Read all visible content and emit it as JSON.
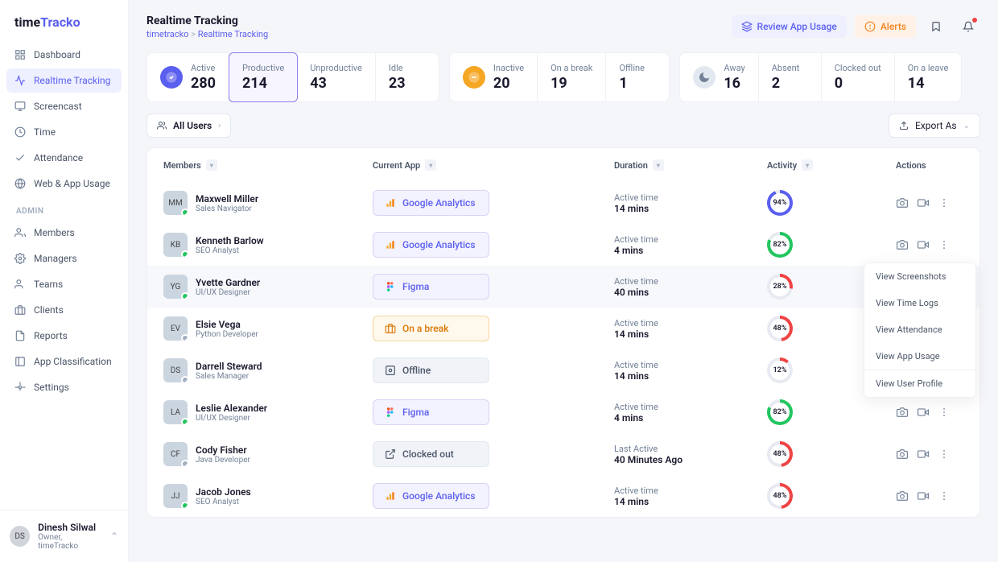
{
  "brand": {
    "part1": "time",
    "part2": "Tracko"
  },
  "nav": {
    "items": [
      {
        "label": "Dashboard"
      },
      {
        "label": "Realtime Tracking"
      },
      {
        "label": "Screencast"
      },
      {
        "label": "Time"
      },
      {
        "label": "Attendance"
      },
      {
        "label": "Web & App Usage"
      }
    ],
    "admin_label": "ADMIN",
    "admin_items": [
      {
        "label": "Members"
      },
      {
        "label": "Managers"
      },
      {
        "label": "Teams"
      },
      {
        "label": "Clients"
      },
      {
        "label": "Reports"
      },
      {
        "label": "App Classification"
      },
      {
        "label": "Settings"
      }
    ]
  },
  "current_user": {
    "name": "Dinesh Silwal",
    "role": "Owner, timeTracko"
  },
  "page": {
    "title": "Realtime Tracking",
    "breadcrumb_root": "timetracko",
    "breadcrumb_sep": ">",
    "breadcrumb_current": "Realtime Tracking"
  },
  "header_actions": {
    "review": "Review App Usage",
    "alerts": "Alerts"
  },
  "stats": {
    "group1": [
      {
        "label": "Active",
        "value": "280",
        "icon": "check"
      },
      {
        "label": "Productive",
        "value": "214",
        "selected": true
      },
      {
        "label": "Unproductive",
        "value": "43"
      },
      {
        "label": "Idle",
        "value": "23"
      }
    ],
    "group2": [
      {
        "label": "Inactive",
        "value": "20",
        "icon": "minus"
      },
      {
        "label": "On a break",
        "value": "19"
      },
      {
        "label": "Offline",
        "value": "1"
      }
    ],
    "group3": [
      {
        "label": "Away",
        "value": "16",
        "icon": "moon"
      },
      {
        "label": "Absent",
        "value": "2"
      },
      {
        "label": "Clocked out",
        "value": "0"
      },
      {
        "label": "On a leave",
        "value": "14"
      }
    ]
  },
  "toolbar": {
    "all_users": "All Users",
    "export": "Export As"
  },
  "columns": {
    "members": "Members",
    "app": "Current App",
    "duration": "Duration",
    "activity": "Activity",
    "actions": "Actions"
  },
  "rows": [
    {
      "name": "Maxwell Miller",
      "role": "Sales Navigator",
      "status": "green",
      "app_type": "ga",
      "app_label": "Google Analytics",
      "dur_label": "Active time",
      "dur_value": "14 mins",
      "pct": "94%",
      "ring_color": "#5b5fef",
      "ring_deg": 338
    },
    {
      "name": "Kenneth Barlow",
      "role": "SEO Analyst",
      "status": "green",
      "app_type": "ga",
      "app_label": "Google Analytics",
      "dur_label": "Active time",
      "dur_value": "4 mins",
      "pct": "82%",
      "ring_color": "#22c55e",
      "ring_deg": 295,
      "popup": true
    },
    {
      "name": "Yvette Gardner",
      "role": "UI/UX Designer",
      "status": "green",
      "app_type": "figma",
      "app_label": "Figma",
      "dur_label": "Active time",
      "dur_value": "40 mins",
      "pct": "28%",
      "ring_color": "#ef4444",
      "ring_deg": 100,
      "highlight": true
    },
    {
      "name": "Elsie Vega",
      "role": "Python Developer",
      "status": "grey",
      "app_type": "break",
      "app_label": "On a break",
      "dur_label": "Active time",
      "dur_value": "14 mins",
      "pct": "48%",
      "ring_color": "#ef4444",
      "ring_deg": 172
    },
    {
      "name": "Darrell Steward",
      "role": "Sales Manager",
      "status": "grey",
      "app_type": "offline",
      "app_label": "Offline",
      "dur_label": "Active time",
      "dur_value": "14 mins",
      "pct": "12%",
      "ring_color": "#ef4444",
      "ring_deg": 43
    },
    {
      "name": "Leslie Alexander",
      "role": "UI/UX Designer",
      "status": "green",
      "app_type": "figma",
      "app_label": "Figma",
      "dur_label": "Active time",
      "dur_value": "4 mins",
      "pct": "82%",
      "ring_color": "#22c55e",
      "ring_deg": 295
    },
    {
      "name": "Cody Fisher",
      "role": "Java Developer",
      "status": "grey",
      "app_type": "clocked",
      "app_label": "Clocked out",
      "dur_label": "Last Active",
      "dur_value": "40 Minutes Ago",
      "pct": "48%",
      "ring_color": "#ef4444",
      "ring_deg": 172
    },
    {
      "name": "Jacob Jones",
      "role": "SEO Analyst",
      "status": "green",
      "app_type": "ga",
      "app_label": "Google Analytics",
      "dur_label": "Active time",
      "dur_value": "14 mins",
      "pct": "48%",
      "ring_color": "#ef4444",
      "ring_deg": 172
    }
  ],
  "popup_items": [
    "View Screenshots",
    "View Time Logs",
    "View Attendance",
    "View App Usage",
    "View User Profile"
  ]
}
